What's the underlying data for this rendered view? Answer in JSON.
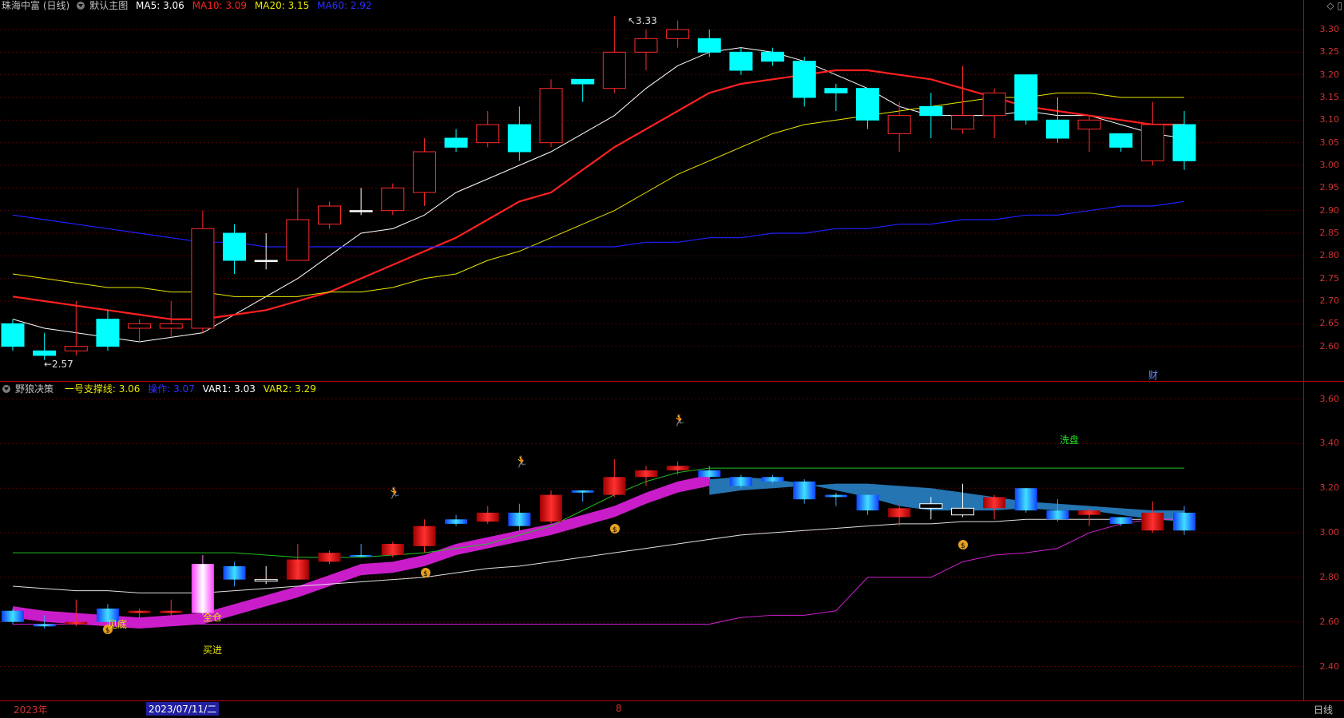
{
  "main": {
    "stock_name": "珠海中富 (日线)",
    "chart_name": "默认主图",
    "ma5_label": "MA5: 3.06",
    "ma10_label": "MA10: 3.09",
    "ma20_label": "MA20: 3.15",
    "ma60_label": "MA60: 2.92",
    "high_annotation": "3.33",
    "low_annotation": "2.57",
    "event_marker": "财",
    "y_ticks": [
      "3.30",
      "3.25",
      "3.20",
      "3.15",
      "3.10",
      "3.05",
      "3.00",
      "2.95",
      "2.90",
      "2.85",
      "2.80",
      "2.75",
      "2.70",
      "2.65",
      "2.60"
    ]
  },
  "sub": {
    "indicator_name": "野狼决策",
    "support_label": "一号支撑线: 3.06",
    "operate_label": "操作: 3.07",
    "var1_label": "VAR1: 3.03",
    "var2_label": "VAR2: 3.29",
    "label_bottom": "见底",
    "label_fullpos": "全仓",
    "label_buy": "买进",
    "label_wash": "洗盘",
    "y_ticks": [
      "3.60",
      "3.40",
      "3.20",
      "3.00",
      "2.80",
      "2.60",
      "2.40"
    ]
  },
  "footer": {
    "year_label": "2023年",
    "cursor_date": "2023/07/11/二",
    "month_label": "8",
    "period_label": "日线"
  },
  "colors": {
    "up": "#ff2a2a",
    "down": "#00ffff",
    "ma5": "#ffffff",
    "ma10": "#ff2020",
    "ma20": "#e8e800",
    "ma60": "#2020ff",
    "grid": "#5a0000"
  },
  "chart_data": {
    "type": "candlestick",
    "series": [
      {
        "name": "MA5",
        "values": [
          2.66,
          2.64,
          2.63,
          2.62,
          2.61,
          2.62,
          2.63,
          2.67,
          2.71,
          2.75,
          2.8,
          2.85,
          2.86,
          2.89,
          2.94,
          2.97,
          3.0,
          3.03,
          3.07,
          3.11,
          3.17,
          3.22,
          3.25,
          3.26,
          3.25,
          3.23,
          3.2,
          3.17,
          3.13,
          3.11,
          3.11,
          3.11,
          3.12,
          3.11,
          3.11,
          3.09,
          3.07,
          3.06
        ]
      },
      {
        "name": "MA10",
        "values": [
          2.71,
          2.7,
          2.69,
          2.68,
          2.67,
          2.66,
          2.66,
          2.67,
          2.68,
          2.7,
          2.72,
          2.75,
          2.78,
          2.81,
          2.84,
          2.88,
          2.92,
          2.94,
          2.99,
          3.04,
          3.08,
          3.12,
          3.16,
          3.18,
          3.19,
          3.2,
          3.21,
          3.21,
          3.2,
          3.19,
          3.17,
          3.15,
          3.13,
          3.12,
          3.11,
          3.1,
          3.09,
          3.09
        ]
      },
      {
        "name": "MA20",
        "values": [
          2.76,
          2.75,
          2.74,
          2.73,
          2.73,
          2.72,
          2.72,
          2.71,
          2.71,
          2.71,
          2.72,
          2.72,
          2.73,
          2.75,
          2.76,
          2.79,
          2.81,
          2.84,
          2.87,
          2.9,
          2.94,
          2.98,
          3.01,
          3.04,
          3.07,
          3.09,
          3.1,
          3.11,
          3.12,
          3.13,
          3.14,
          3.15,
          3.15,
          3.16,
          3.16,
          3.15,
          3.15,
          3.15
        ]
      },
      {
        "name": "MA60",
        "values": [
          2.89,
          2.88,
          2.87,
          2.86,
          2.85,
          2.84,
          2.83,
          2.83,
          2.82,
          2.82,
          2.82,
          2.82,
          2.82,
          2.82,
          2.82,
          2.82,
          2.82,
          2.82,
          2.82,
          2.82,
          2.83,
          2.83,
          2.84,
          2.84,
          2.85,
          2.85,
          2.86,
          2.86,
          2.87,
          2.87,
          2.88,
          2.88,
          2.89,
          2.89,
          2.9,
          2.91,
          2.91,
          2.92
        ]
      }
    ],
    "candles": [
      [
        2.65,
        2.6,
        2.66,
        2.59
      ],
      [
        2.59,
        2.58,
        2.63,
        2.57
      ],
      [
        2.59,
        2.6,
        2.7,
        2.58
      ],
      [
        2.66,
        2.6,
        2.68,
        2.59
      ],
      [
        2.64,
        2.65,
        2.66,
        2.61
      ],
      [
        2.64,
        2.65,
        2.7,
        2.62
      ],
      [
        2.64,
        2.86,
        2.9,
        2.63
      ],
      [
        2.85,
        2.79,
        2.87,
        2.76
      ],
      [
        2.79,
        2.79,
        2.85,
        2.77
      ],
      [
        2.79,
        2.88,
        2.95,
        2.79
      ],
      [
        2.87,
        2.91,
        2.92,
        2.86
      ],
      [
        2.9,
        2.9,
        2.95,
        2.89
      ],
      [
        2.9,
        2.95,
        2.96,
        2.89
      ],
      [
        2.94,
        3.03,
        3.06,
        2.91
      ],
      [
        3.06,
        3.04,
        3.08,
        3.03
      ],
      [
        3.05,
        3.09,
        3.12,
        3.04
      ],
      [
        3.09,
        3.03,
        3.13,
        3.01
      ],
      [
        3.05,
        3.17,
        3.19,
        3.04
      ],
      [
        3.19,
        3.18,
        3.19,
        3.14
      ],
      [
        3.17,
        3.25,
        3.33,
        3.16
      ],
      [
        3.25,
        3.28,
        3.3,
        3.21
      ],
      [
        3.28,
        3.3,
        3.32,
        3.26
      ],
      [
        3.28,
        3.25,
        3.3,
        3.24
      ],
      [
        3.25,
        3.21,
        3.26,
        3.2
      ],
      [
        3.25,
        3.23,
        3.26,
        3.22
      ],
      [
        3.23,
        3.15,
        3.24,
        3.13
      ],
      [
        3.17,
        3.16,
        3.18,
        3.12
      ],
      [
        3.17,
        3.1,
        3.17,
        3.08
      ],
      [
        3.07,
        3.11,
        3.14,
        3.03
      ],
      [
        3.13,
        3.11,
        3.16,
        3.06
      ],
      [
        3.08,
        3.11,
        3.22,
        3.07
      ],
      [
        3.11,
        3.16,
        3.17,
        3.06
      ],
      [
        3.2,
        3.1,
        3.2,
        3.09
      ],
      [
        3.1,
        3.06,
        3.15,
        3.05
      ],
      [
        3.08,
        3.1,
        3.11,
        3.03
      ],
      [
        3.07,
        3.04,
        3.07,
        3.03
      ],
      [
        3.01,
        3.09,
        3.14,
        3.0
      ],
      [
        3.09,
        3.01,
        3.12,
        2.99
      ]
    ],
    "ylim": [
      2.55,
      3.33
    ]
  }
}
